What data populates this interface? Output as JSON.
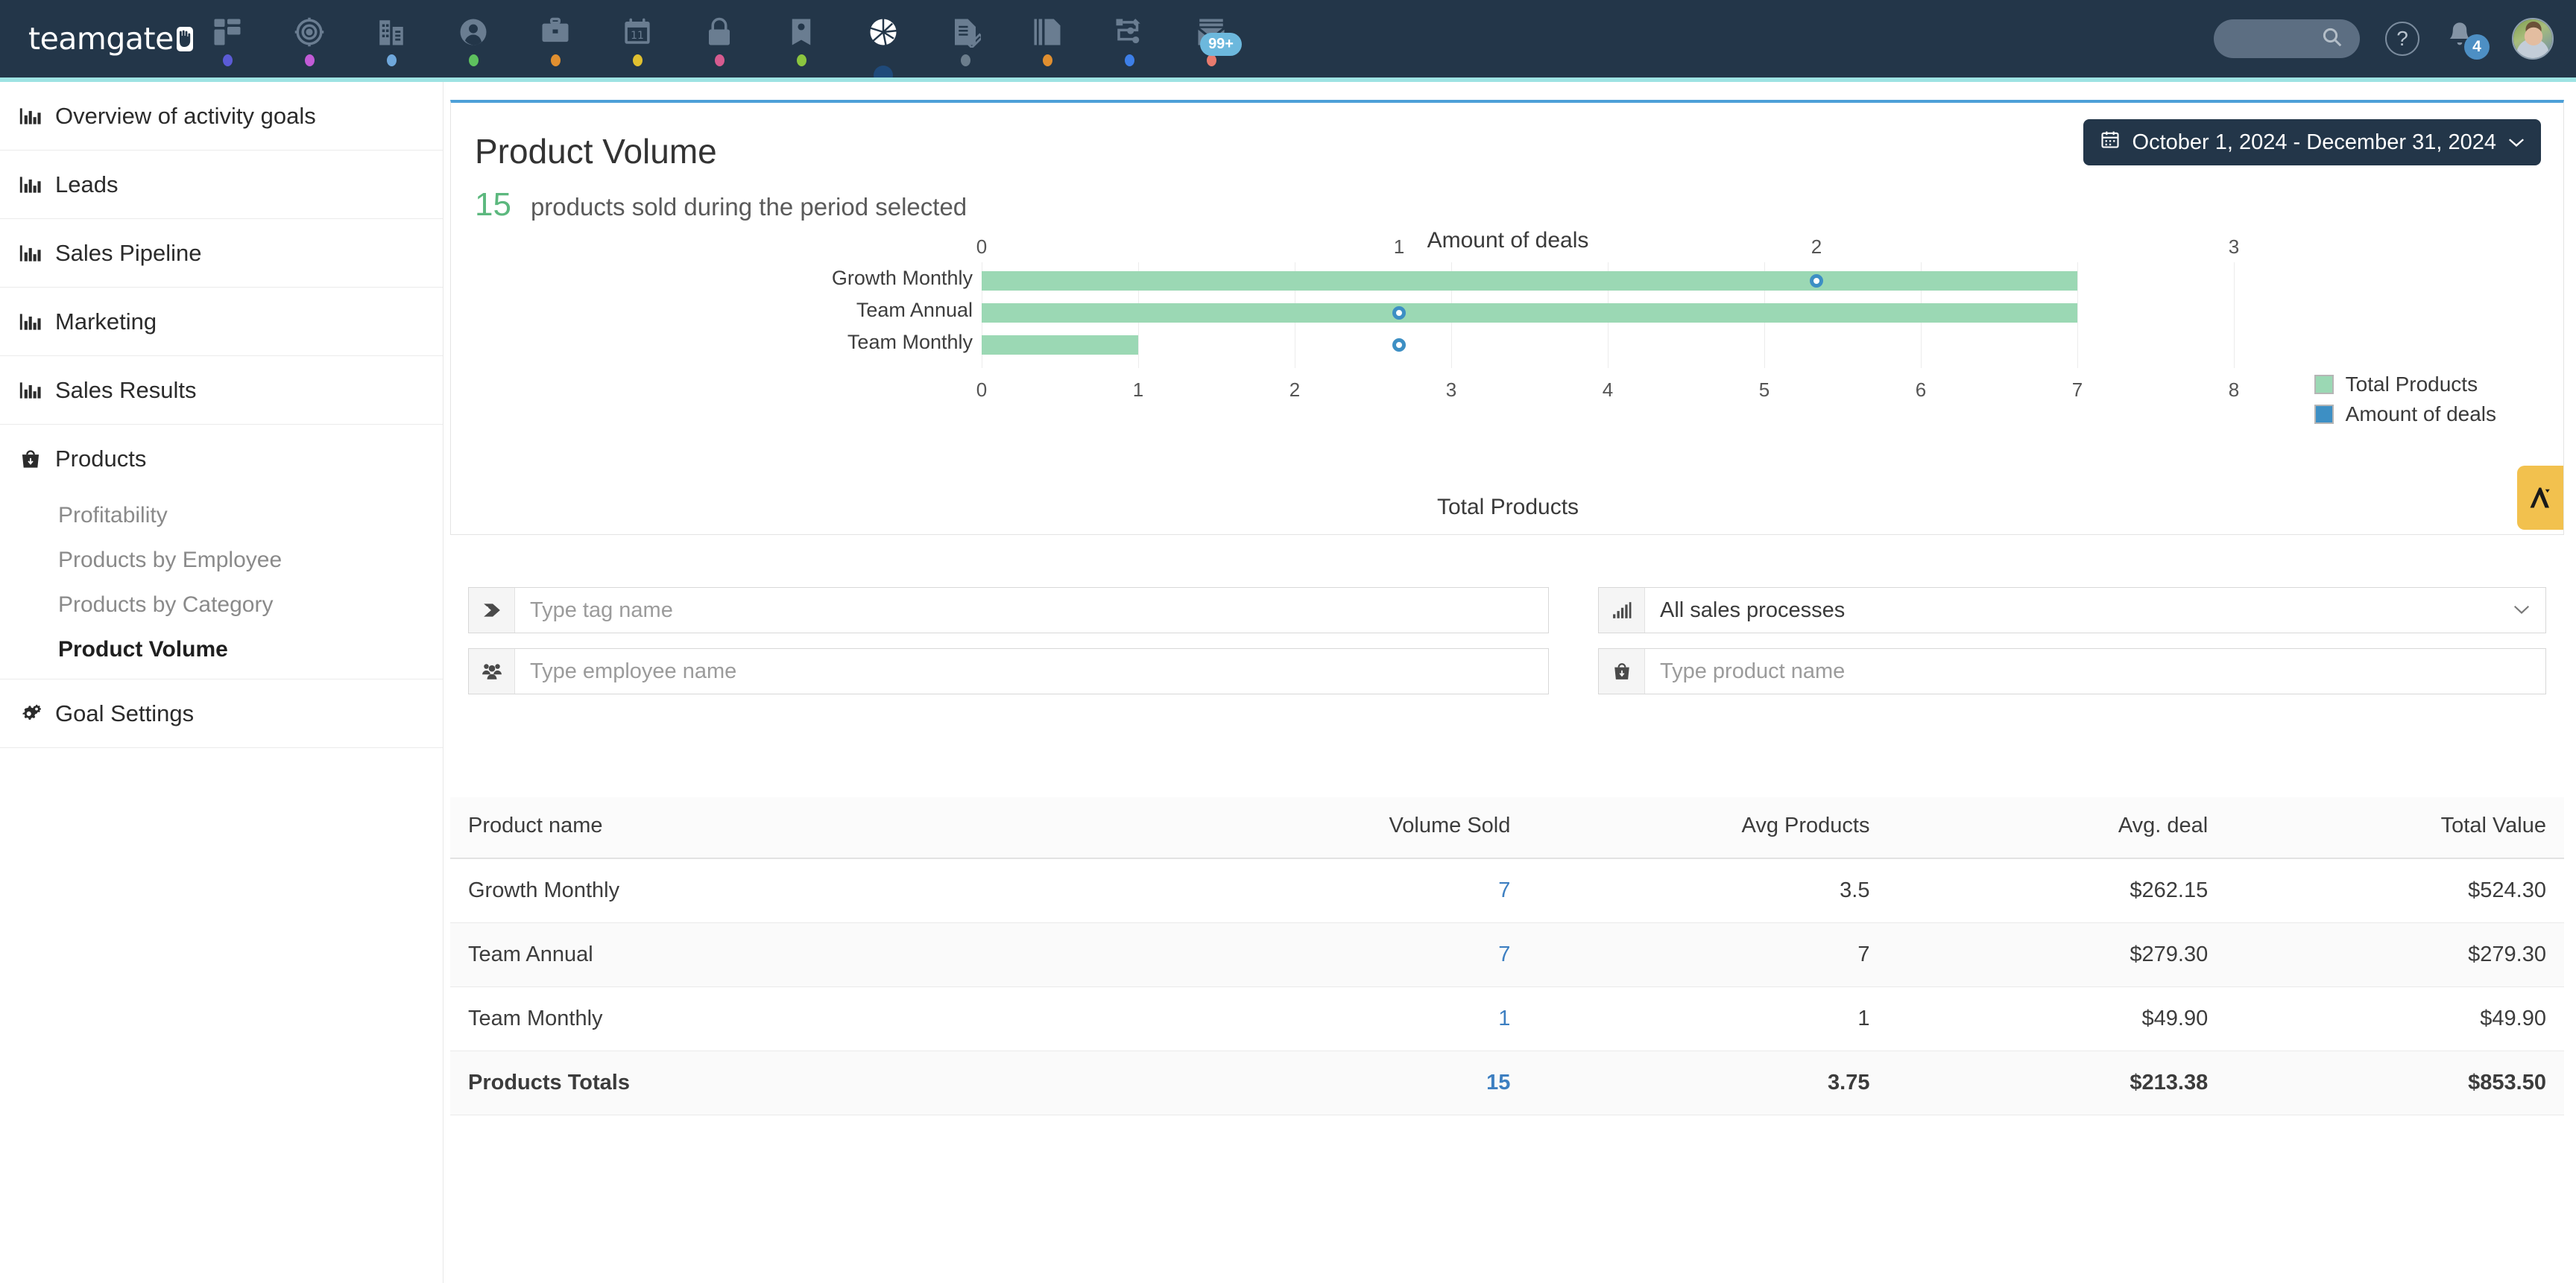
{
  "topnav": {
    "brand": "teamgate",
    "brand_icon": "hand-logo-icon",
    "items": [
      {
        "icon": "dashboard-icon",
        "dot": "#5b5bd6",
        "label": "Dashboard"
      },
      {
        "icon": "target-icon",
        "dot": "#c15bd6",
        "label": "Goals"
      },
      {
        "icon": "company-icon",
        "dot": "#6fa8dc",
        "label": "Companies"
      },
      {
        "icon": "contact-icon",
        "dot": "#5ec15e",
        "label": "Contacts"
      },
      {
        "icon": "briefcase-icon",
        "dot": "#e08f30",
        "label": "Deals"
      },
      {
        "icon": "calendar-icon",
        "dot": "#e0c030",
        "label": "Calendar"
      },
      {
        "icon": "lock-icon",
        "dot": "#d65b8f",
        "label": "Locked"
      },
      {
        "icon": "tag-icon",
        "dot": "#8bc53f",
        "label": "Tags"
      },
      {
        "icon": "pie-chart-icon",
        "dot": "",
        "label": "Insights",
        "active": true
      },
      {
        "icon": "document-edit-icon",
        "dot": "#6b7d8c",
        "label": "Quotes"
      },
      {
        "icon": "documents-icon",
        "dot": "#e08f30",
        "label": "Documents"
      },
      {
        "icon": "workflow-icon",
        "dot": "#3d7fe8",
        "label": "Workflow"
      },
      {
        "icon": "mail-icon",
        "dot": "#e87b6e",
        "label": "Mail",
        "badge": "99+"
      }
    ],
    "search_icon": "search-icon",
    "help_icon": "question-mark-icon",
    "bell_icon": "bell-icon",
    "bell_count": "4",
    "avatar_icon": "user-avatar"
  },
  "sidebar": {
    "items": [
      {
        "label": "Overview of activity goals",
        "icon": "bar-chart-icon"
      },
      {
        "label": "Leads",
        "icon": "bar-chart-icon"
      },
      {
        "label": "Sales Pipeline",
        "icon": "bar-chart-icon"
      },
      {
        "label": "Marketing",
        "icon": "bar-chart-icon"
      },
      {
        "label": "Sales Results",
        "icon": "bar-chart-icon"
      },
      {
        "label": "Products",
        "icon": "products-bag-icon"
      }
    ],
    "sub_items": [
      {
        "label": "Profitability",
        "active": false
      },
      {
        "label": "Products by Employee",
        "active": false
      },
      {
        "label": "Products by Category",
        "active": false
      },
      {
        "label": "Product Volume",
        "active": true
      }
    ],
    "footer_item": {
      "label": "Goal Settings",
      "icon": "gears-icon"
    }
  },
  "card": {
    "title": "Product Volume",
    "count": "15",
    "subtitle": "products sold during the period selected",
    "expand_icon": "expand-arrows-icon",
    "calendar_icon": "calendar-icon",
    "date_range": "October 1, 2024 - December 31, 2024",
    "chevron_icon": "chevron-down-icon",
    "side_tab_icon": "teamgate-mark-icon"
  },
  "chart_data": {
    "type": "bar",
    "title": "",
    "orientation": "horizontal",
    "categories": [
      "Growth Monthly",
      "Team Annual",
      "Team Monthly"
    ],
    "series": [
      {
        "name": "Total Products",
        "values": [
          7,
          7,
          1
        ],
        "color": "#9bd8b4",
        "axis": "bottom"
      },
      {
        "name": "Amount of deals",
        "values": [
          2,
          1,
          1
        ],
        "color": "#3d8fc4",
        "axis": "top",
        "marker": "circle"
      }
    ],
    "top_axis": {
      "label": "Amount of deals",
      "ticks": [
        0,
        1,
        2,
        3
      ],
      "range": [
        0,
        3
      ]
    },
    "bottom_axis": {
      "label": "Total Products",
      "ticks": [
        0,
        1,
        2,
        3,
        4,
        5,
        6,
        7,
        8
      ],
      "range": [
        0,
        8
      ]
    },
    "legend": [
      "Total Products",
      "Amount of deals"
    ],
    "legend_position": "right",
    "grid": true
  },
  "filters": {
    "tag": {
      "icon": "tag-icon",
      "placeholder": "Type tag name",
      "value": ""
    },
    "employee": {
      "icon": "people-icon",
      "placeholder": "Type employee name",
      "value": ""
    },
    "process": {
      "icon": "bar-chart-icon",
      "value": "All sales processes",
      "caret": "chevron-down-icon"
    },
    "product": {
      "icon": "products-bag-icon",
      "placeholder": "Type product name",
      "value": ""
    }
  },
  "table": {
    "columns": [
      "Product name",
      "Volume Sold",
      "Avg Products",
      "Avg. deal",
      "Total Value"
    ],
    "rows": [
      {
        "name": "Growth Monthly",
        "volume": "7",
        "avg_products": "3.5",
        "avg_deal": "$262.15",
        "total": "$524.30"
      },
      {
        "name": "Team Annual",
        "volume": "7",
        "avg_products": "7",
        "avg_deal": "$279.30",
        "total": "$279.30"
      },
      {
        "name": "Team Monthly",
        "volume": "1",
        "avg_products": "1",
        "avg_deal": "$49.90",
        "total": "$49.90"
      }
    ],
    "totals": {
      "name": "Products Totals",
      "volume": "15",
      "avg_products": "3.75",
      "avg_deal": "$213.38",
      "total": "$853.50"
    }
  },
  "colors": {
    "nav_bg": "#233649",
    "accent_line": "#9ee3e3",
    "card_top": "#4da0d8",
    "bar_green": "#9bd8b4",
    "marker_blue": "#3d8fc4",
    "count_green": "#5cb87e",
    "link_blue": "#3d7fc1",
    "side_tab_yellow": "#f2c14e"
  }
}
